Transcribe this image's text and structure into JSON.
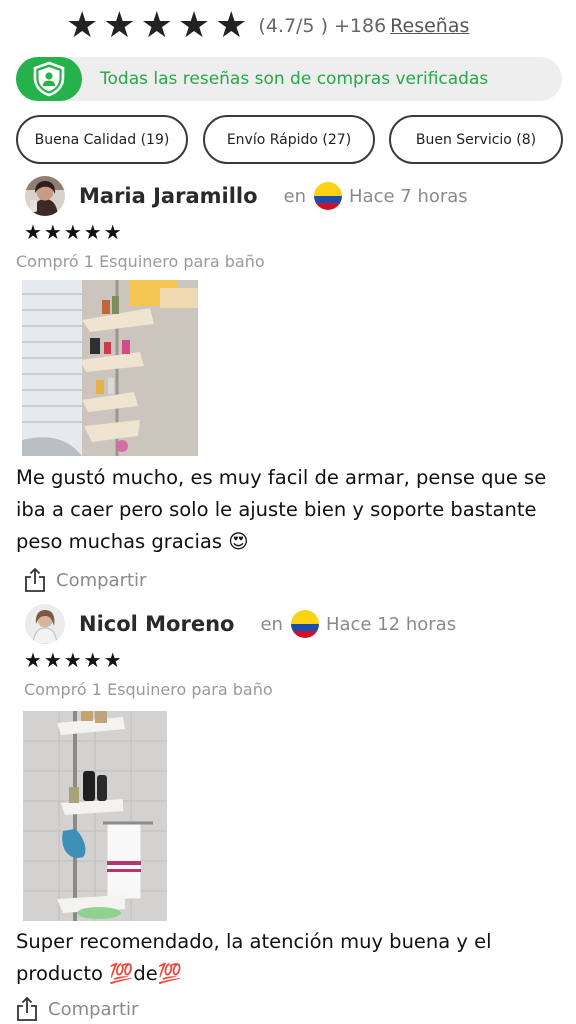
{
  "summary": {
    "stars": [
      "★",
      "★",
      "★",
      "★",
      "★"
    ],
    "score": "(4.7/5 )",
    "count": "+186",
    "reviews_link": "Reseñas"
  },
  "verified_banner": {
    "icon": "shield-user-icon",
    "text": "Todas las reseñas son de compras verificadas",
    "accent": "#26b24b"
  },
  "tags": [
    {
      "label": "Buena Calidad (19)"
    },
    {
      "label": "Envío Rápido (27)"
    },
    {
      "label": "Buen Servicio (8)"
    }
  ],
  "reviews": [
    {
      "name": "Maria Jaramillo",
      "en": "en",
      "country_icon": "colombia-flag-icon",
      "time": "Hace 7 horas",
      "stars": "★★★★★",
      "purchase": "Compró 1 Esquinero para baño",
      "text": "Me gustó mucho, es muy facil de armar, pense que se iba a caer pero solo le ajuste bien y soporte bastante peso muchas gracias 😍",
      "share": "Compartir"
    },
    {
      "name": "Nicol Moreno",
      "en": "en",
      "country_icon": "colombia-flag-icon",
      "time": "Hace 12 horas",
      "stars": "★★★★★",
      "purchase": "Compró 1 Esquinero para baño",
      "text": "Super recomendado, la atención muy buena y el producto 💯de💯",
      "share": "Compartir"
    }
  ]
}
